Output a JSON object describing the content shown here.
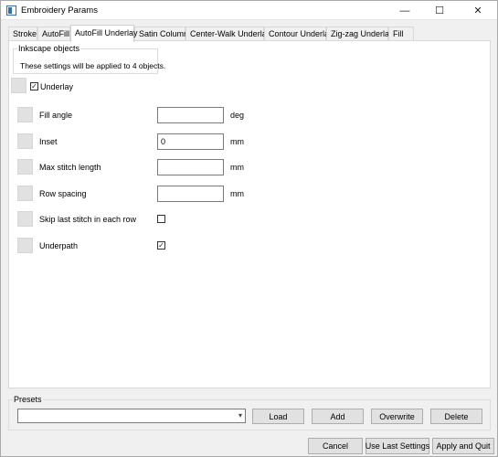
{
  "window": {
    "title": "Embroidery Params",
    "controls": {
      "minimize": "—",
      "maximize": "☐",
      "close": "✕"
    }
  },
  "tabs": [
    {
      "label": "Stroke"
    },
    {
      "label": "AutoFill"
    },
    {
      "label": "AutoFill Underlay",
      "active": true
    },
    {
      "label": "Satin Column"
    },
    {
      "label": "Center-Walk Underlay"
    },
    {
      "label": "Contour Underlay"
    },
    {
      "label": "Zig-zag Underlay"
    },
    {
      "label": "Fill"
    }
  ],
  "inkscape": {
    "title": "Inkscape objects",
    "message": "These settings will be applied to 4 objects."
  },
  "underlay": {
    "label": "Underlay",
    "checked": true,
    "check_glyph": "✓"
  },
  "params": {
    "fill_angle": {
      "label": "Fill angle",
      "value": "",
      "unit": "deg"
    },
    "inset": {
      "label": "Inset",
      "value": "0",
      "unit": "mm"
    },
    "max_stitch_length": {
      "label": "Max stitch length",
      "value": "",
      "unit": "mm"
    },
    "row_spacing": {
      "label": "Row spacing",
      "value": "",
      "unit": "mm"
    },
    "skip_last_stitch": {
      "label": "Skip last stitch in each row",
      "checked": false,
      "check_glyph": ""
    },
    "underpath": {
      "label": "Underpath",
      "checked": true,
      "check_glyph": "✓"
    }
  },
  "presets": {
    "title": "Presets",
    "selected": "",
    "dropdown_glyph": "▾",
    "load": "Load",
    "add": "Add",
    "overwrite": "Overwrite",
    "delete": "Delete"
  },
  "footer": {
    "cancel": "Cancel",
    "use_last": "Use Last Settings",
    "apply_quit": "Apply and Quit"
  }
}
